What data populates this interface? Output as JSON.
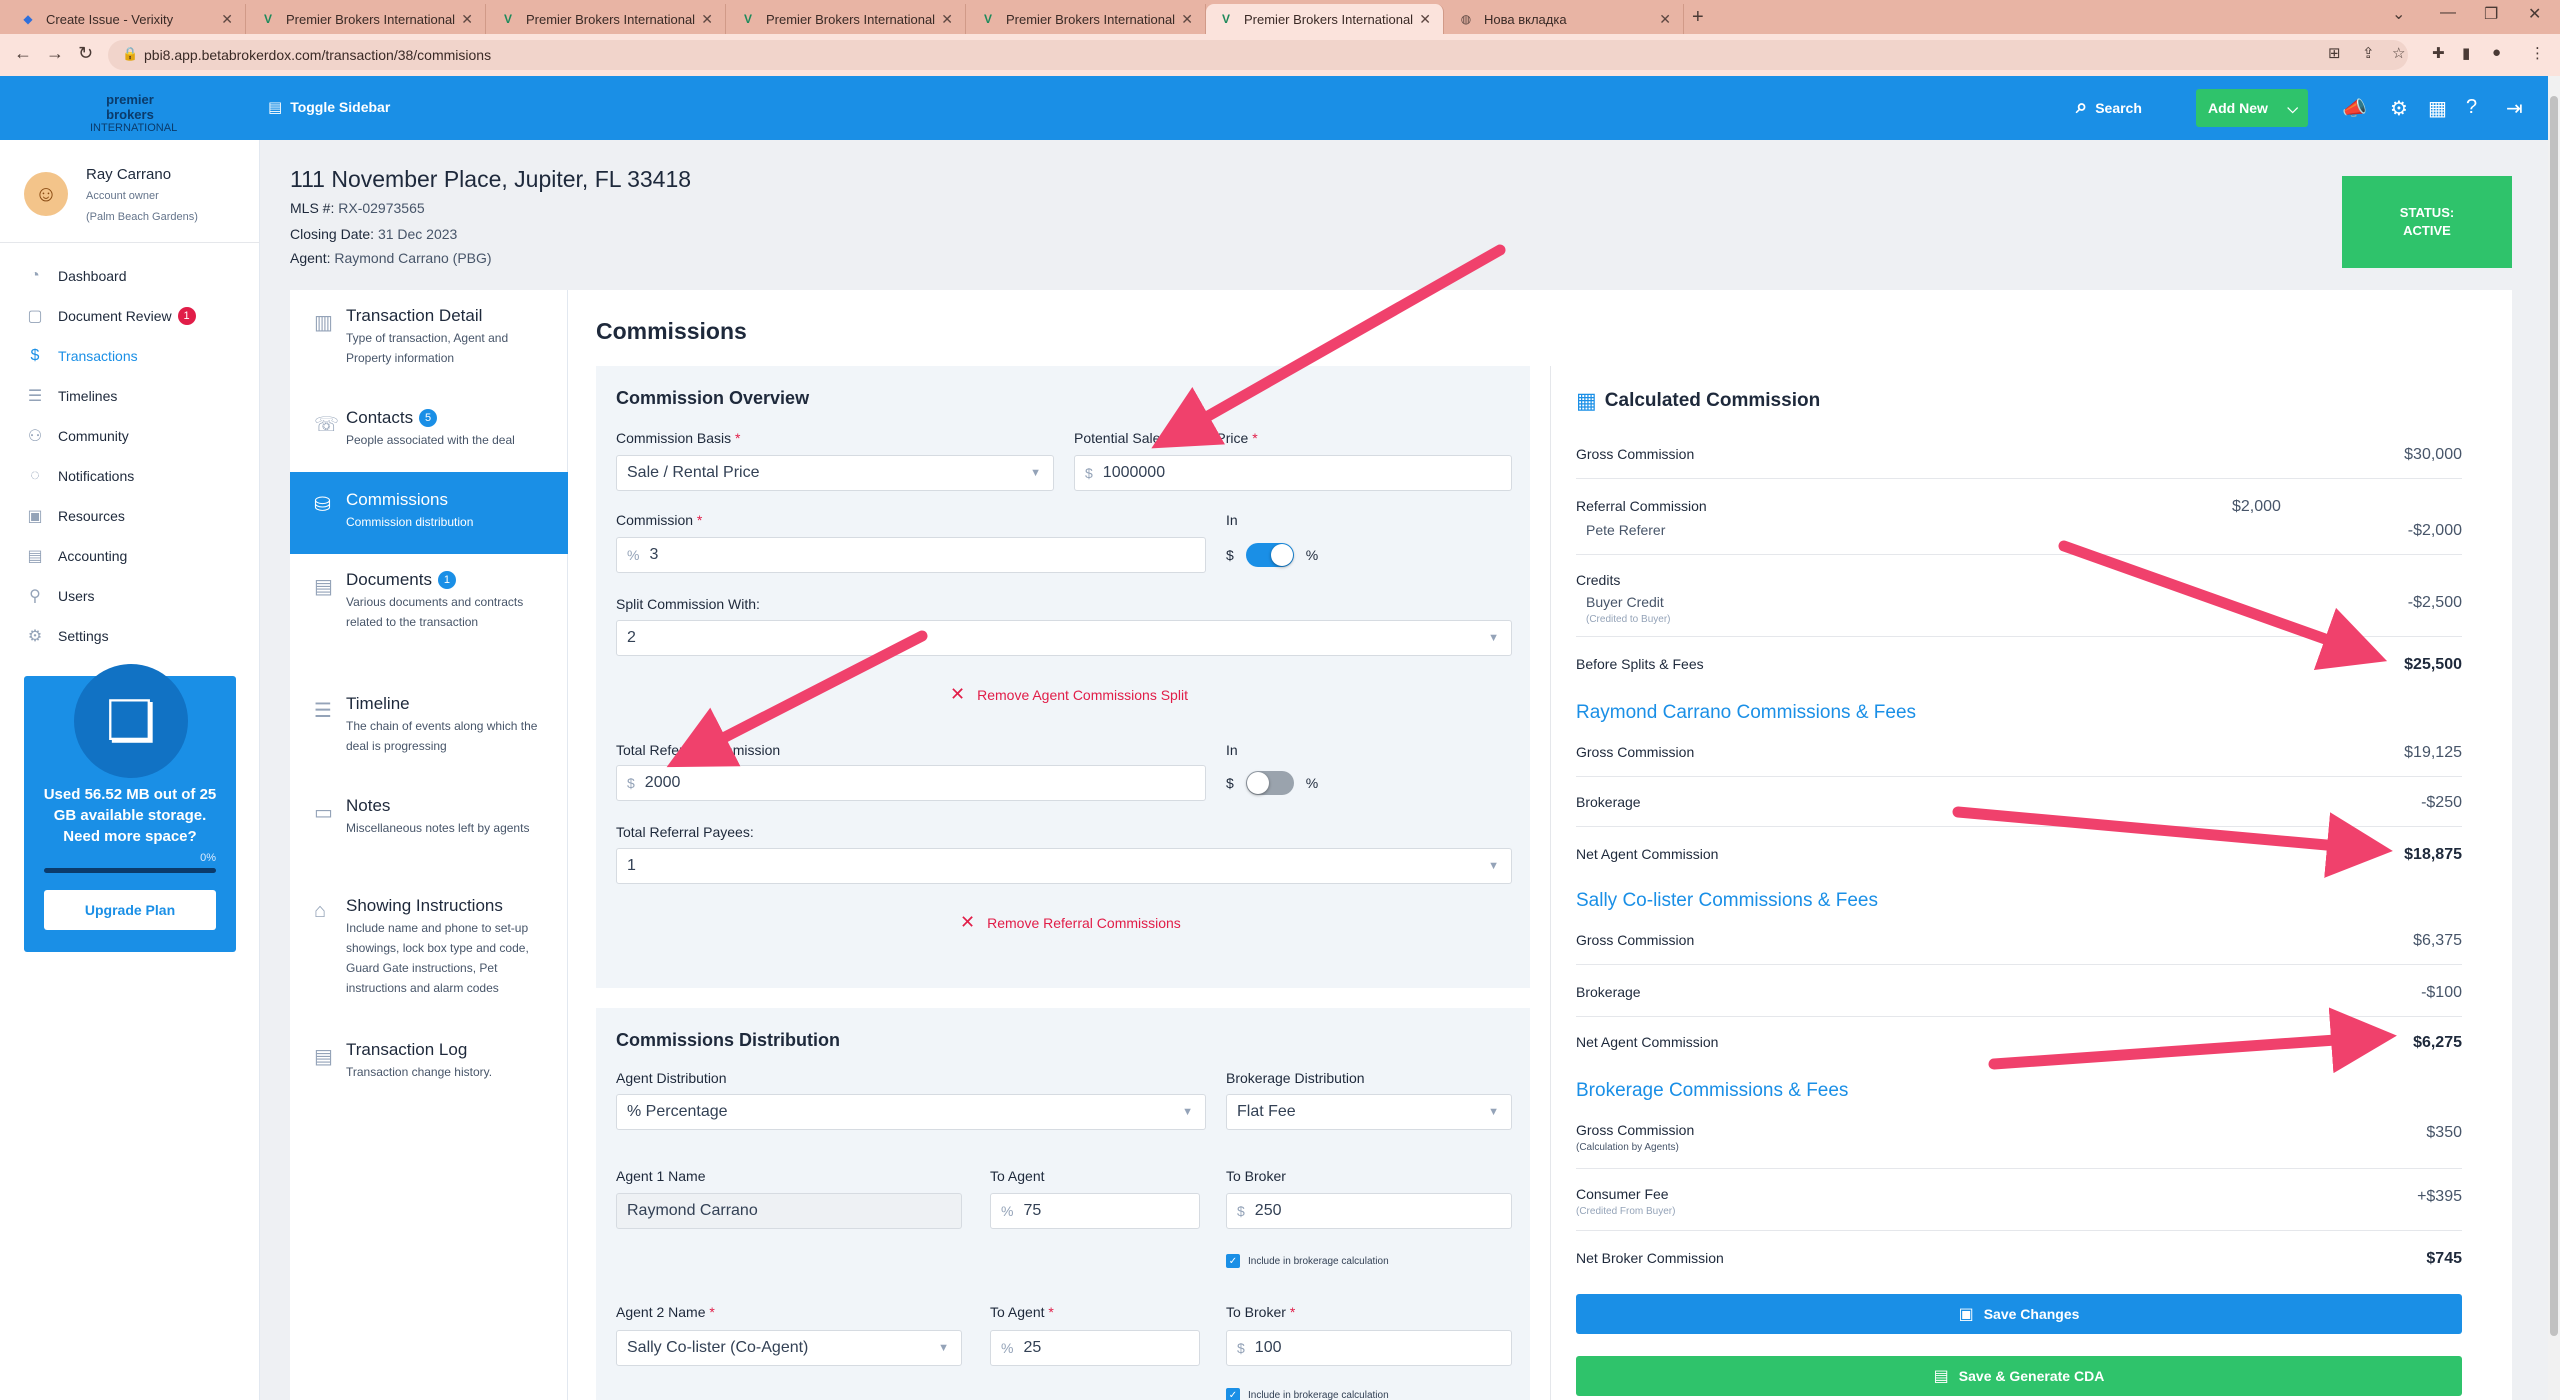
{
  "browser": {
    "tabs": [
      {
        "title": "Create Issue - Verixity",
        "active": false
      },
      {
        "title": "Premier Brokers International Br",
        "active": false
      },
      {
        "title": "Premier Brokers International Br",
        "active": false
      },
      {
        "title": "Premier Brokers International Br",
        "active": false
      },
      {
        "title": "Premier Brokers International Br",
        "active": false
      },
      {
        "title": "Premier Brokers International Br",
        "active": true
      },
      {
        "title": "Нова вкладка",
        "active": false
      }
    ],
    "url": "pbi8.app.betabrokerdox.com/transaction/38/commisions"
  },
  "header": {
    "logo_line1": "premier brokers",
    "logo_line2": "INTERNATIONAL",
    "toggle_label": "Toggle Sidebar",
    "search_label": "Search",
    "add_new_label": "Add New",
    "accent": "#1a8fe6",
    "green": "#2fc36b"
  },
  "user": {
    "name": "Ray Carrano",
    "role": "Account owner",
    "location": "(Palm Beach Gardens)"
  },
  "nav": [
    {
      "label": "Dashboard",
      "icon": "dashboard-icon"
    },
    {
      "label": "Document Review",
      "icon": "document-icon",
      "badge": "1"
    },
    {
      "label": "Transactions",
      "icon": "transactions-icon",
      "active": true
    },
    {
      "label": "Timelines",
      "icon": "timeline-icon"
    },
    {
      "label": "Community",
      "icon": "community-icon"
    },
    {
      "label": "Notifications",
      "icon": "bell-icon"
    },
    {
      "label": "Resources",
      "icon": "resources-icon"
    },
    {
      "label": "Accounting",
      "icon": "accounting-icon"
    },
    {
      "label": "Users",
      "icon": "users-icon"
    },
    {
      "label": "Settings",
      "icon": "gear-icon"
    }
  ],
  "storage": {
    "line1": "Used 56.52 MB out of 25",
    "line2": "GB available storage.",
    "line3": "Need more space?",
    "percent_label": "0%",
    "percent_value": 0,
    "upgrade_label": "Upgrade Plan"
  },
  "transaction": {
    "address": "111 November Place, Jupiter, FL 33418",
    "mls_label": "MLS #:",
    "mls": "RX-02973565",
    "closing_label": "Closing Date:",
    "closing": "31 Dec 2023",
    "agent_label": "Agent:",
    "agent": "Raymond Carrano (PBG)",
    "status_label": "STATUS:",
    "status_value": "ACTIVE"
  },
  "sections": [
    {
      "title": "Transaction Detail",
      "desc": "Type of transaction, Agent and Property information"
    },
    {
      "title": "Contacts",
      "badge": "5",
      "desc": "People associated with the deal"
    },
    {
      "title": "Commissions",
      "desc": "Commission distribution",
      "active": true
    },
    {
      "title": "Documents",
      "badge": "1",
      "desc": "Various documents and contracts related to the transaction"
    },
    {
      "title": "Timeline",
      "desc": "The chain of events along which the deal is progressing"
    },
    {
      "title": "Notes",
      "desc": "Miscellaneous notes left by agents"
    },
    {
      "title": "Showing Instructions",
      "desc": "Include name and phone to set-up showings, lock box type and code, Guard Gate instructions, Pet instructions and alarm codes"
    },
    {
      "title": "Transaction Log",
      "desc": "Transaction change history."
    }
  ],
  "commissions": {
    "heading": "Commissions",
    "overview": {
      "title": "Commission Overview",
      "basis_label": "Commission Basis",
      "basis_value": "Sale / Rental Price",
      "price_label": "Potential Sale / Rental Price",
      "price_prefix": "$",
      "price_value": "1000000",
      "commission_label": "Commission",
      "commission_prefix": "%",
      "commission_value": "3",
      "in_label": "In",
      "dollar": "$",
      "percent": "%",
      "split_label": "Split Commission With:",
      "split_value": "2",
      "remove_split": "Remove Agent Commissions Split",
      "referral_label": "Total Referral Commission",
      "referral_prefix": "$",
      "referral_value": "2000",
      "payees_label": "Total Referral Payees:",
      "payees_value": "1",
      "remove_referral": "Remove Referral Commissions"
    },
    "distribution": {
      "title": "Commissions Distribution",
      "agent_dist_label": "Agent Distribution",
      "agent_dist_value": "% Percentage",
      "broker_dist_label": "Brokerage Distribution",
      "broker_dist_value": "Flat Fee",
      "agent1_label": "Agent 1 Name",
      "agent1_value": "Raymond Carrano",
      "to_agent_label": "To Agent",
      "to_broker_label": "To Broker",
      "agent1_to_agent": "75",
      "agent1_to_broker": "250",
      "include_label": "Include in brokerage calculation",
      "agent2_label": "Agent 2 Name",
      "agent2_value": "Sally Co-lister (Co-Agent)",
      "agent2_to_agent": "25",
      "agent2_to_broker": "100",
      "pct_prefix": "%",
      "usd_prefix": "$"
    }
  },
  "calculated": {
    "title": "Calculated Commission",
    "gross_label": "Gross Commission",
    "gross_value": "$30,000",
    "referral_label": "Referral Commission",
    "referral_mid": "$2,000",
    "referral_name": "Pete Referer",
    "referral_value": "-$2,000",
    "credits_label": "Credits",
    "credit_name": "Buyer Credit",
    "credit_note": "(Credited to Buyer)",
    "credit_value": "-$2,500",
    "before_label": "Before Splits & Fees",
    "before_value": "$25,500",
    "raymond": {
      "heading": "Raymond Carrano Commissions & Fees",
      "gross_label": "Gross Commission",
      "gross_value": "$19,125",
      "brokerage_label": "Brokerage",
      "brokerage_value": "-$250",
      "net_label": "Net Agent Commission",
      "net_value": "$18,875"
    },
    "sally": {
      "heading": "Sally Co-lister Commissions & Fees",
      "gross_label": "Gross Commission",
      "gross_value": "$6,375",
      "brokerage_label": "Brokerage",
      "brokerage_value": "-$100",
      "net_label": "Net Agent Commission",
      "net_value": "$6,275"
    },
    "brokerage": {
      "heading": "Brokerage Commissions & Fees",
      "gross_label": "Gross Commission",
      "gross_note": "(Calculation by Agents)",
      "gross_value": "$350",
      "consumer_label": "Consumer Fee",
      "consumer_note": "(Credited From Buyer)",
      "consumer_value": "+$395",
      "net_label": "Net Broker Commission",
      "net_value": "$745"
    },
    "save_label": "Save Changes",
    "save_cda_label": "Save & Generate CDA"
  }
}
